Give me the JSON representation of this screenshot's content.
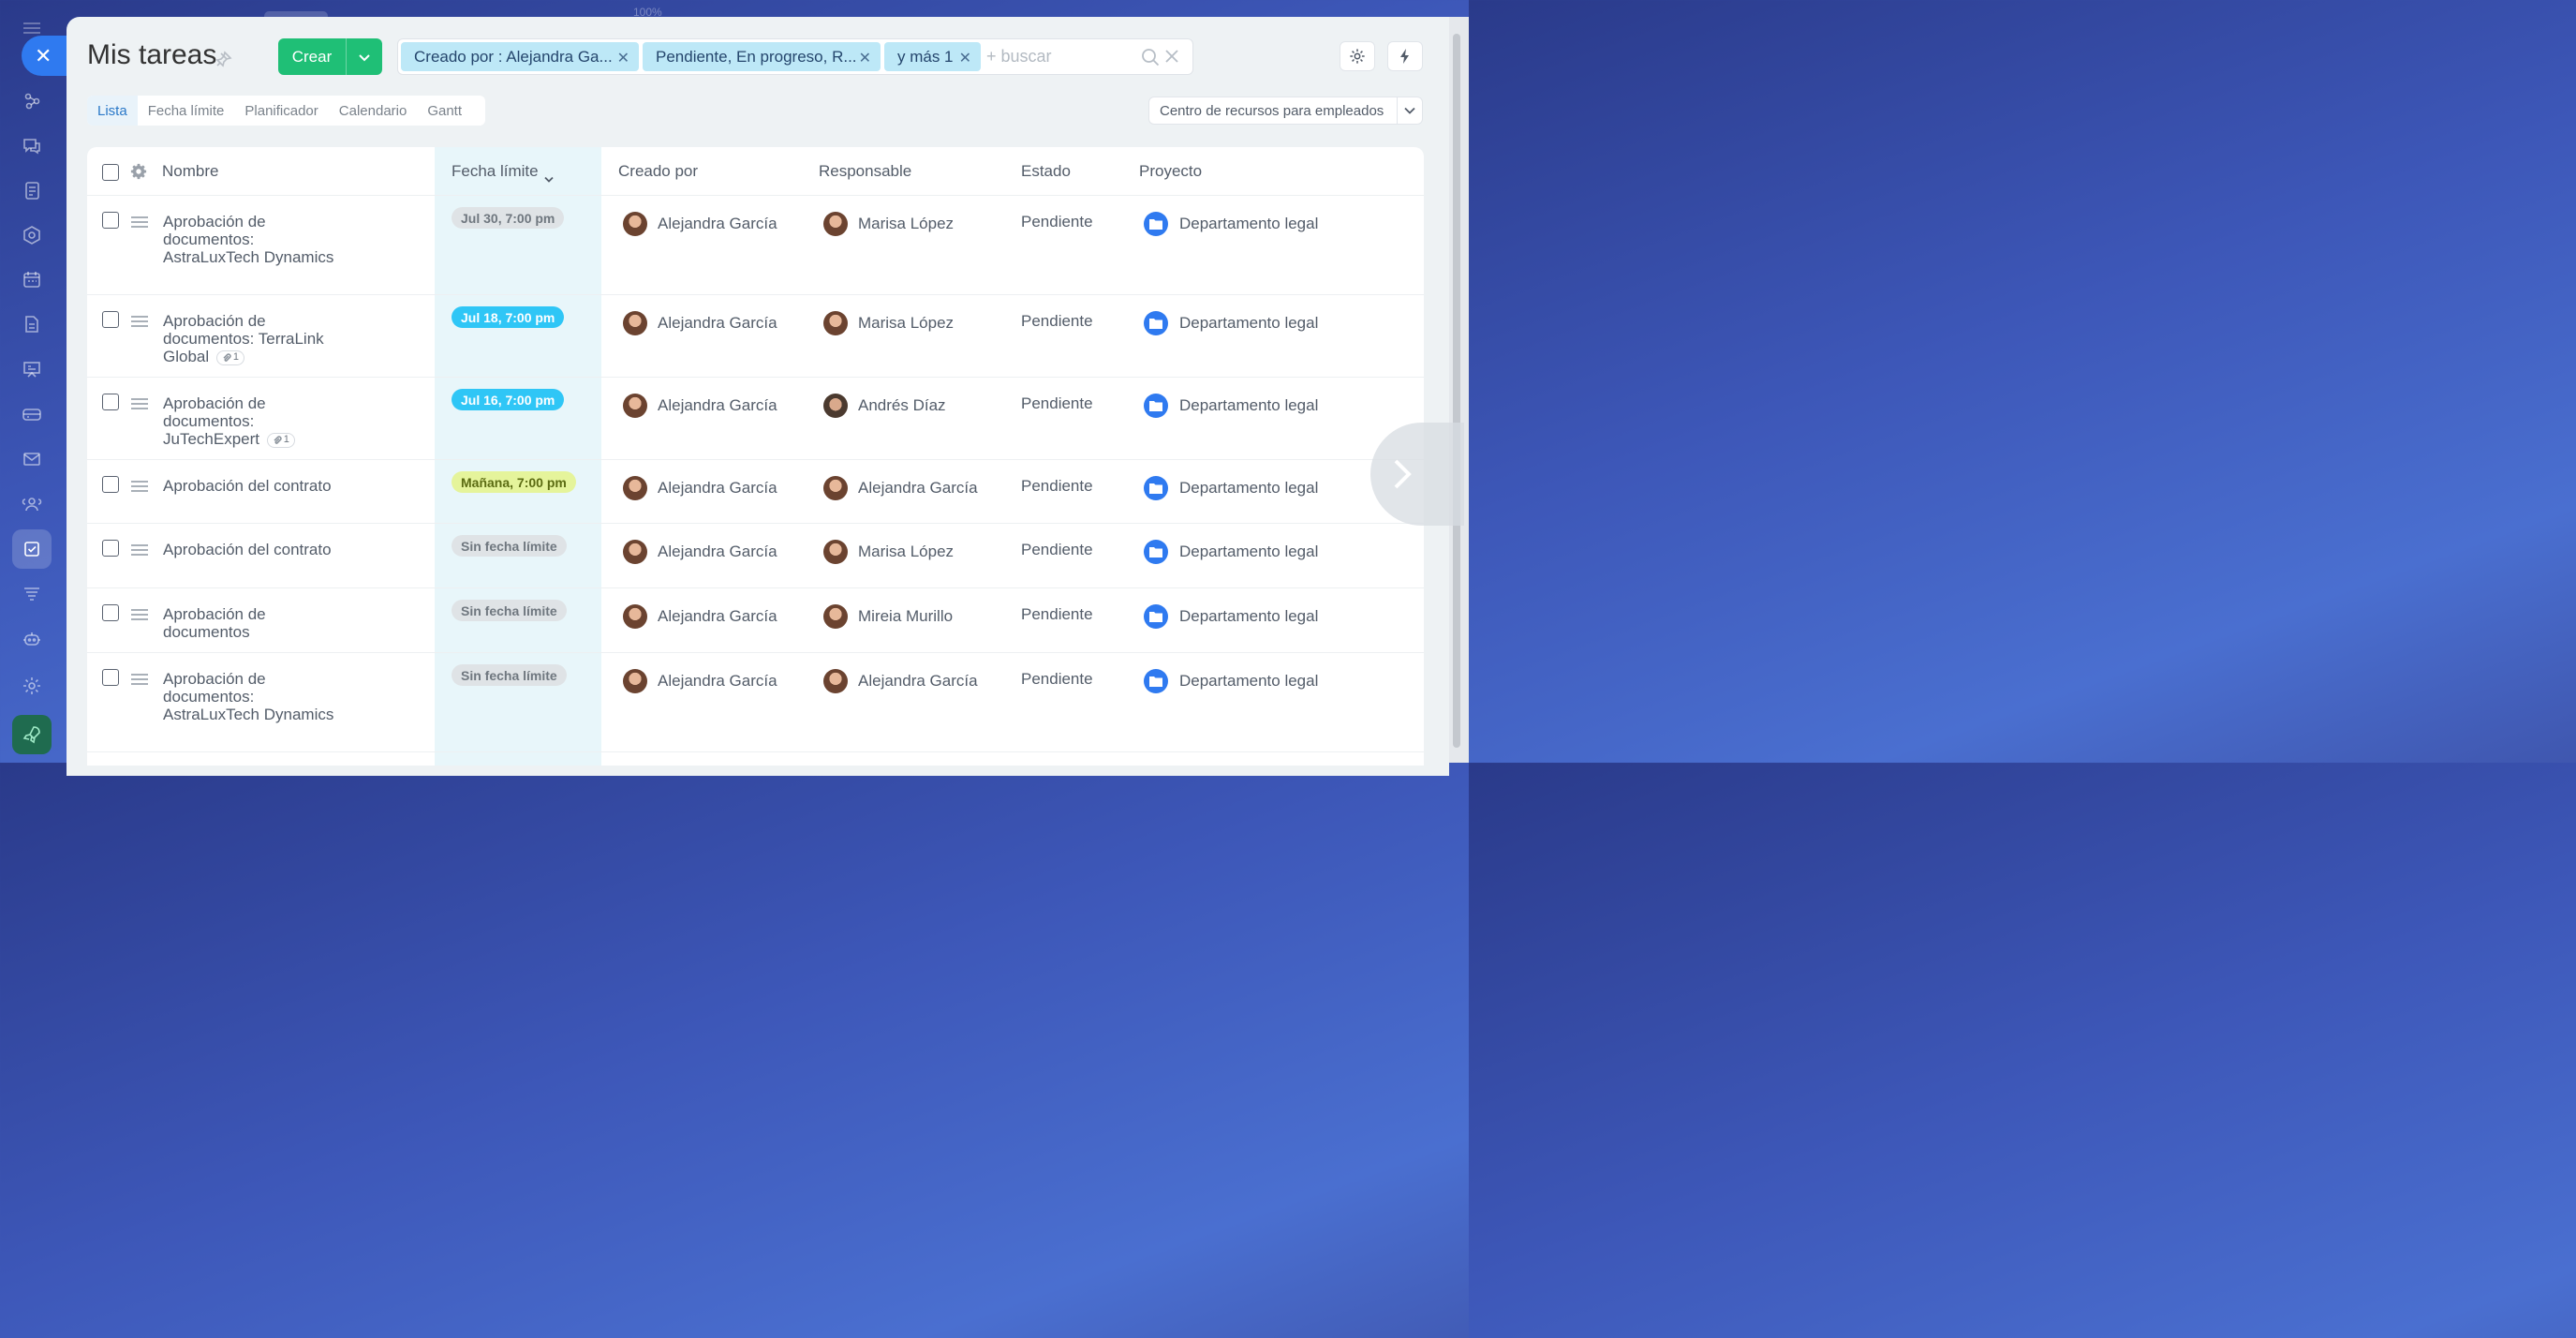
{
  "topbar": {
    "zoom": "100%"
  },
  "page": {
    "title": "Mis tareas"
  },
  "toolbar": {
    "create_label": "Crear",
    "filters": [
      {
        "label": "Creado por : Alejandra Ga..."
      },
      {
        "label": "Pendiente, En progreso, R..."
      },
      {
        "label": "y más 1"
      }
    ],
    "search_placeholder": "+ buscar"
  },
  "tabs": [
    {
      "label": "Lista",
      "active": true
    },
    {
      "label": "Fecha límite",
      "active": false
    },
    {
      "label": "Planificador",
      "active": false
    },
    {
      "label": "Calendario",
      "active": false
    },
    {
      "label": "Gantt",
      "active": false
    }
  ],
  "scope": {
    "label": "Centro de recursos para empleados"
  },
  "table": {
    "columns": {
      "name": "Nombre",
      "deadline": "Fecha límite",
      "created_by": "Creado por",
      "responsible": "Responsable",
      "status": "Estado",
      "project": "Proyecto"
    },
    "rows": [
      {
        "name_lines": [
          "Aprobación de",
          "documentos:",
          "AstraLuxTech Dynamics"
        ],
        "attachments": null,
        "deadline": "Jul 30, 7:00 pm",
        "deadline_style": "gray",
        "created_by": "Alejandra García",
        "responsible": "Marisa López",
        "status": "Pendiente",
        "project": "Departamento legal"
      },
      {
        "name_lines": [
          "Aprobación de",
          "documentos: TerraLink",
          "Global"
        ],
        "attachments": "1",
        "deadline": "Jul 18, 7:00 pm",
        "deadline_style": "blue",
        "created_by": "Alejandra García",
        "responsible": "Marisa López",
        "status": "Pendiente",
        "project": "Departamento legal"
      },
      {
        "name_lines": [
          "Aprobación de",
          "documentos:",
          "JuTechExpert"
        ],
        "attachments": "1",
        "deadline": "Jul 16, 7:00 pm",
        "deadline_style": "blue",
        "created_by": "Alejandra García",
        "responsible": "Andrés Díaz",
        "status": "Pendiente",
        "project": "Departamento legal"
      },
      {
        "name_lines": [
          "Aprobación del contrato"
        ],
        "attachments": null,
        "deadline": "Mañana, 7:00 pm",
        "deadline_style": "yellow",
        "created_by": "Alejandra García",
        "responsible": "Alejandra García",
        "status": "Pendiente",
        "project": "Departamento legal"
      },
      {
        "name_lines": [
          "Aprobación del contrato"
        ],
        "attachments": null,
        "deadline": "Sin fecha límite",
        "deadline_style": "gray",
        "created_by": "Alejandra García",
        "responsible": "Marisa López",
        "status": "Pendiente",
        "project": "Departamento legal"
      },
      {
        "name_lines": [
          "Aprobación de",
          "documentos"
        ],
        "attachments": null,
        "deadline": "Sin fecha límite",
        "deadline_style": "gray",
        "created_by": "Alejandra García",
        "responsible": "Mireia Murillo",
        "status": "Pendiente",
        "project": "Departamento legal"
      },
      {
        "name_lines": [
          "Aprobación de",
          "documentos:",
          "AstraLuxTech Dynamics"
        ],
        "attachments": null,
        "deadline": "Sin fecha límite",
        "deadline_style": "gray",
        "created_by": "Alejandra García",
        "responsible": "Alejandra García",
        "status": "Pendiente",
        "project": "Departamento legal"
      }
    ]
  },
  "colors": {
    "accent": "#2f7af0",
    "create_button": "#1fbf76",
    "filter_chip": "#bde8f7",
    "deadline_blue": "#2fc6f6",
    "deadline_yellow": "#e5f49b",
    "deadline_gray": "#dfe3e6"
  },
  "icons": {
    "rail": [
      "sales-funnel-icon",
      "chat-icon",
      "feed-icon",
      "hexagon-icon",
      "calendar-icon",
      "document-icon",
      "presentation-icon",
      "card-icon",
      "mail-icon",
      "employees-icon",
      "tasks-icon",
      "filter-stack-icon",
      "robot-icon",
      "settings-icon",
      "rocket-icon"
    ]
  }
}
